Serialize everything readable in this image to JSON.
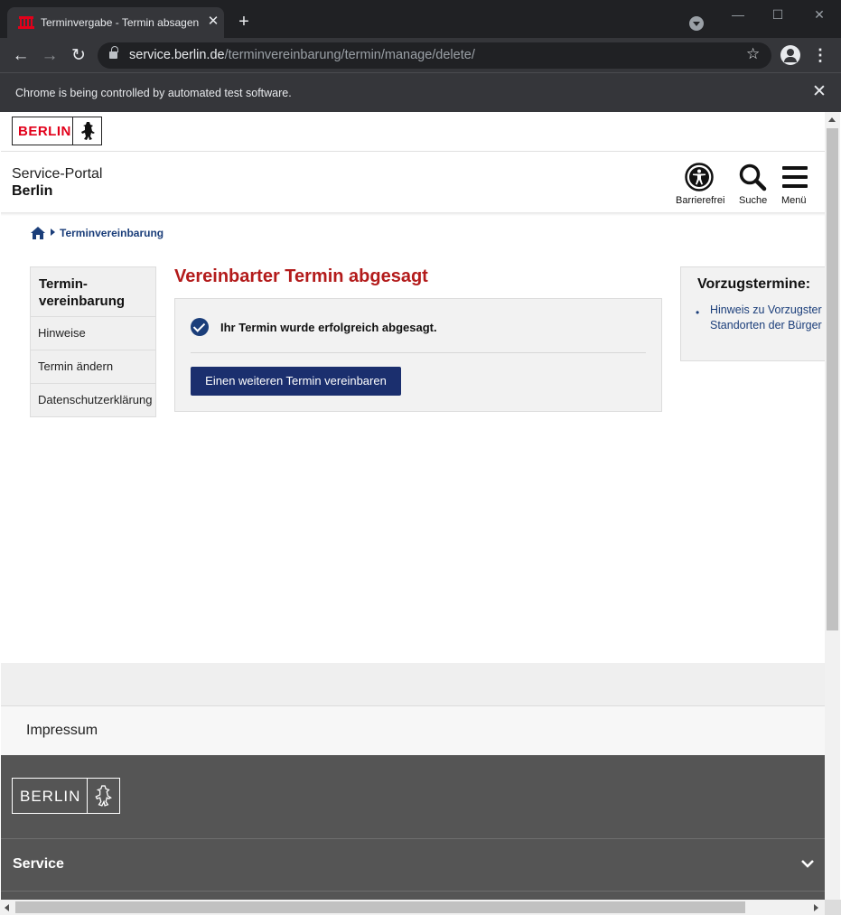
{
  "browser": {
    "tab_title": "Terminvergabe - Termin absagen",
    "new_tab": "+",
    "url_host": "service.berlin.de",
    "url_path": "/terminvereinbarung/termin/manage/delete/",
    "infobar_text": "Chrome is being controlled by automated test software.",
    "close_glyph": "✕",
    "back_glyph": "←",
    "forward_glyph": "→",
    "reload_glyph": "↻",
    "star_glyph": "☆",
    "menu_glyph": "⋮",
    "minimize_glyph": "—",
    "maximize_glyph": "☐"
  },
  "header": {
    "logo_text": "BERLIN",
    "portal_line1": "Service-Portal",
    "portal_line2": "Berlin",
    "icons": [
      {
        "label": "Barrierefrei",
        "icon": "accessibility-icon"
      },
      {
        "label": "Suche",
        "icon": "search-icon"
      },
      {
        "label": "Menü",
        "icon": "menu-icon"
      }
    ]
  },
  "breadcrumb": {
    "home_icon": "home-icon",
    "link": "Terminvereinbarung"
  },
  "sidenav": {
    "title_line1": "Termin-",
    "title_line2": "vereinbarung",
    "items": [
      "Hinweise",
      "Termin ändern",
      "Datenschutzerklärung"
    ]
  },
  "main": {
    "title": "Vereinbarter Termin abgesagt",
    "success_text": "Ihr Termin wurde erfolgreich abgesagt.",
    "button_label": "Einen weiteren Termin vereinbaren"
  },
  "aside": {
    "title": "Vorzugstermine:",
    "link_line1": "Hinweis zu Vorzugster",
    "link_line2": "Standorten der Bürger"
  },
  "footer": {
    "impressum": "Impressum",
    "logo_text": "BERLIN",
    "service": "Service"
  },
  "colors": {
    "accent_blue": "#1b2f6e",
    "title_red": "#b31b1b",
    "logo_red": "#e2001a",
    "footer_dark": "#555555"
  }
}
